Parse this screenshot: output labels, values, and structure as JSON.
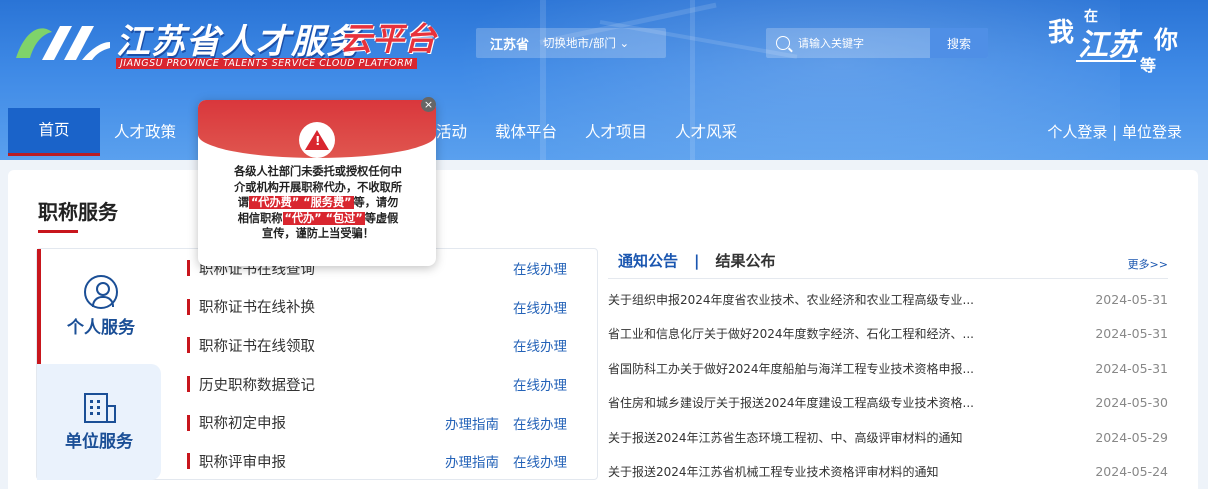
{
  "header": {
    "logo_title": "江苏省人才服务",
    "logo_cloud": "云平台",
    "logo_subtitle": "JIANGSU PROVINCE TALENTS SERVICE CLOUD PLATFORM",
    "province": "江苏省",
    "switch_region": "切换地市/部门 ⌄",
    "search_placeholder": "请输入关键字",
    "search_button": "搜索",
    "slogan": {
      "s1": "我",
      "s2": "在",
      "s3": "江苏",
      "s4": "你",
      "s5": "等"
    }
  },
  "nav": {
    "items": [
      {
        "label": "首页"
      },
      {
        "label": "人才政策"
      },
      {
        "label": "活动"
      },
      {
        "label": "载体平台"
      },
      {
        "label": "人才项目"
      },
      {
        "label": "人才风采"
      }
    ],
    "login_personal": "个人登录",
    "login_sep": " | ",
    "login_unit": "单位登录"
  },
  "main": {
    "section_title": "职称服务",
    "tabs": {
      "personal": "个人服务",
      "unit": "单位服务"
    },
    "services": [
      {
        "name": "职称证书在线查询",
        "guide": "",
        "online": "在线办理"
      },
      {
        "name": "职称证书在线补换",
        "guide": "",
        "online": "在线办理"
      },
      {
        "name": "职称证书在线领取",
        "guide": "",
        "online": "在线办理"
      },
      {
        "name": "历史职称数据登记",
        "guide": "",
        "online": "在线办理"
      },
      {
        "name": "职称初定申报",
        "guide": "办理指南",
        "online": "在线办理"
      },
      {
        "name": "职称评审申报",
        "guide": "办理指南",
        "online": "在线办理"
      }
    ]
  },
  "notice": {
    "tab_notice": "通知公告",
    "tab_sep": "|",
    "tab_results": "结果公布",
    "more": "更多>>",
    "items": [
      {
        "title": "关于组织申报2024年度省农业技术、农业经济和农业工程高级专业...",
        "date": "2024-05-31"
      },
      {
        "title": "省工业和信息化厅关于做好2024年度数字经济、石化工程和经济、...",
        "date": "2024-05-31"
      },
      {
        "title": "省国防科工办关于做好2024年度船舶与海洋工程专业技术资格申报...",
        "date": "2024-05-31"
      },
      {
        "title": "省住房和城乡建设厅关于报送2024年度建设工程高级专业技术资格...",
        "date": "2024-05-30"
      },
      {
        "title": "关于报送2024年江苏省生态环境工程初、中、高级评审材料的通知",
        "date": "2024-05-29"
      },
      {
        "title": "关于报送2024年江苏省机械工程专业技术资格评审材料的通知",
        "date": "2024-05-24"
      }
    ]
  },
  "popup": {
    "line1": "各级人社部门未委托或授权任何中",
    "line2": "介或机构开展职称代办，不收取所",
    "line3_pre": "谓",
    "hl1": "“代办费”",
    "hl2": "“服务费”",
    "line3_post": "等，请勿",
    "line4_pre": "相信职称",
    "hl3": "“代办”",
    "hl4": "“包过”",
    "line4_post": "等虚假",
    "line5": "宣传，谨防上当受骗！",
    "close": "×"
  }
}
